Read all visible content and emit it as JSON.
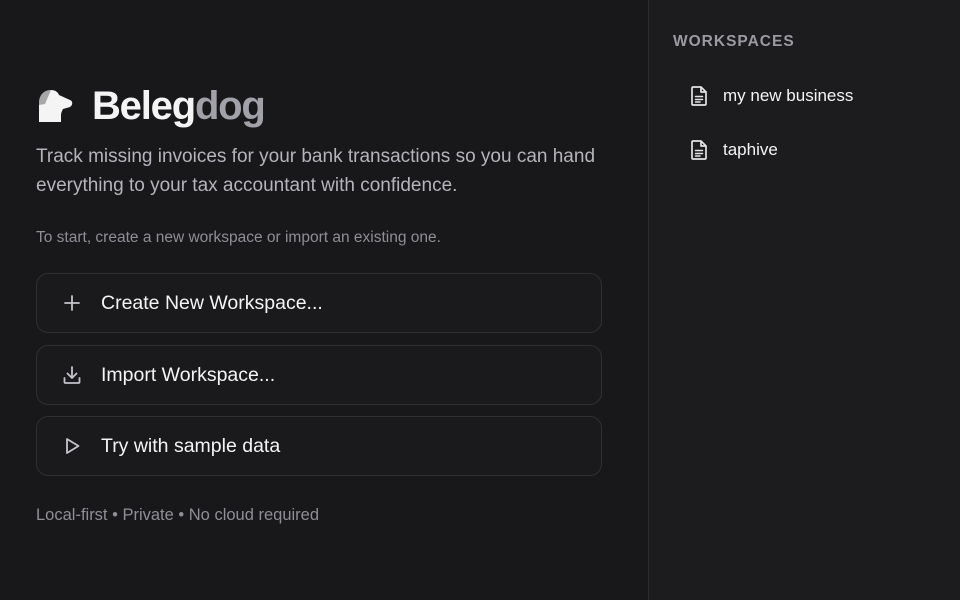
{
  "brand": {
    "name_primary": "Beleg",
    "name_secondary": "dog",
    "logo_icon": "dog-logo-icon"
  },
  "intro": {
    "tagline": "Track missing invoices for your bank transactions so you can hand everything to your tax accountant with confidence.",
    "hint": "To start, create a new workspace or import an existing one."
  },
  "actions": [
    {
      "label": "Create New Workspace...",
      "icon": "plus-icon"
    },
    {
      "label": "Import Workspace...",
      "icon": "download-icon"
    },
    {
      "label": "Try with sample data",
      "icon": "play-icon"
    }
  ],
  "footer": {
    "text": "Local-first • Private • No cloud required"
  },
  "sidebar": {
    "heading": "WORKSPACES",
    "items": [
      {
        "label": "my new business",
        "icon": "document-icon"
      },
      {
        "label": "taphive",
        "icon": "document-icon"
      }
    ]
  },
  "colors": {
    "background": "#18181b",
    "sidebar_background": "#1c1c1f",
    "text_primary": "#f4f4f5",
    "text_muted": "#8e8e96",
    "brand_secondary": "#a1a1aa"
  }
}
